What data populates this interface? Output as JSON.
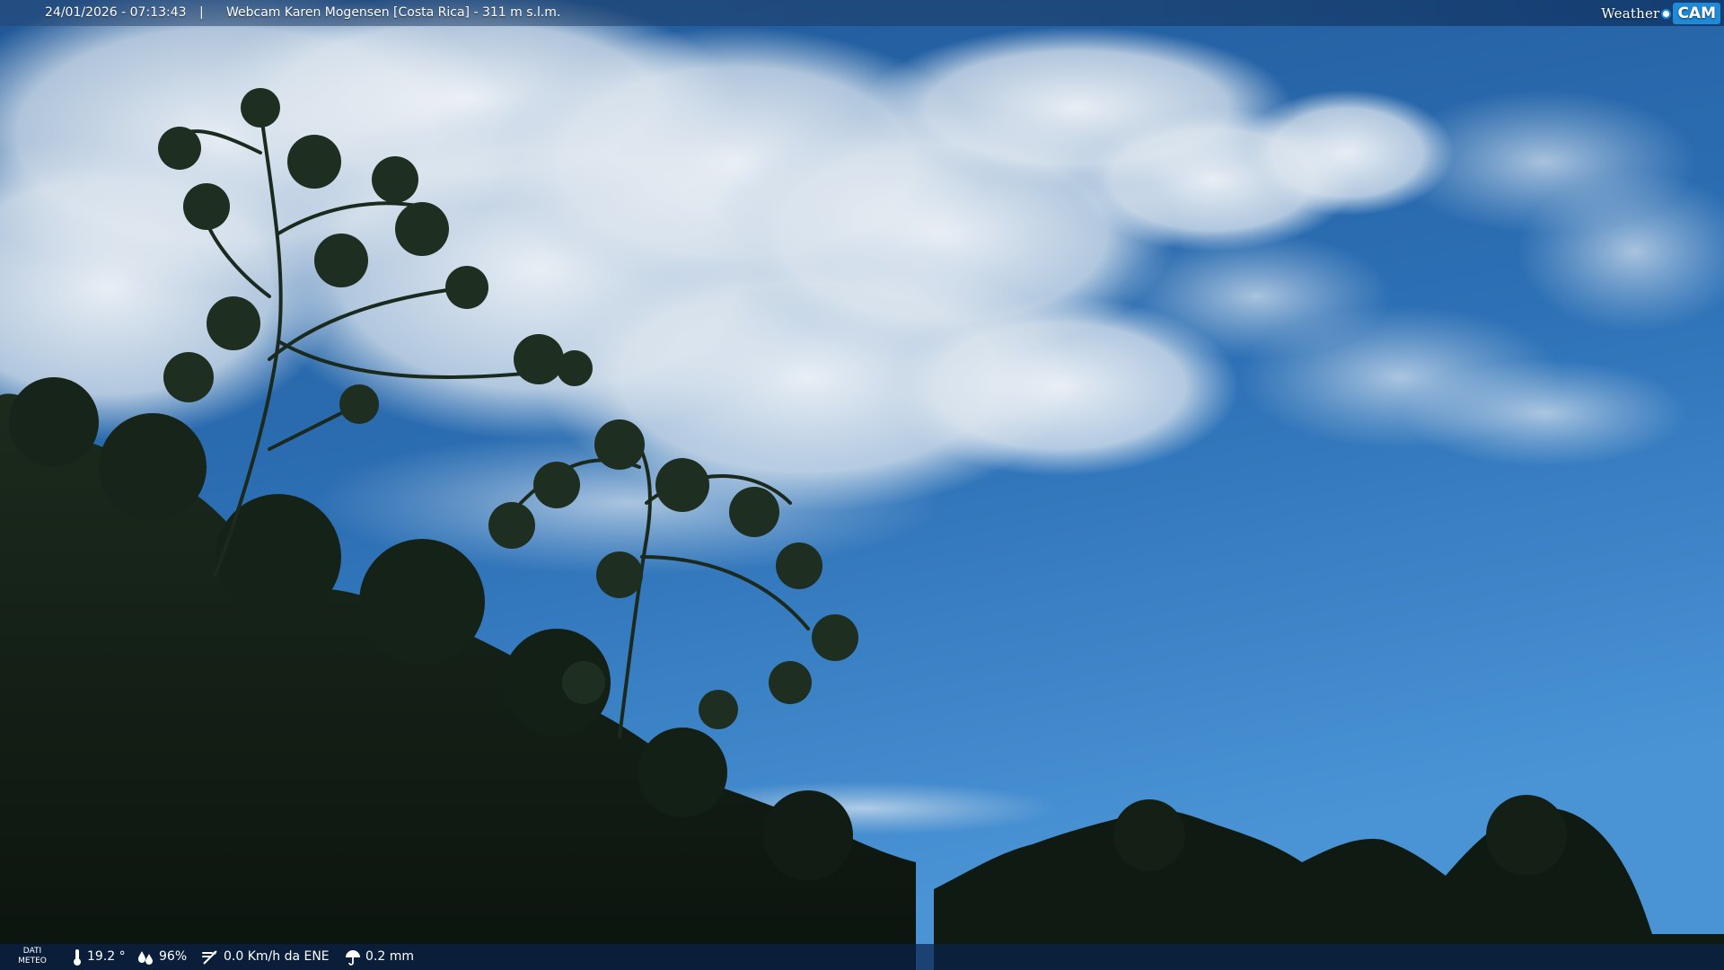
{
  "header": {
    "datetime": "24/01/2026 - 07:13:43",
    "separator": "|",
    "title": "Webcam Karen Mogensen [Costa Rica] - 311 m s.l.m."
  },
  "logo": {
    "weather_text": "Weather",
    "cam_text": "CAM",
    "accent_color": "#1f8ad6"
  },
  "footer": {
    "label_line1": "DATI",
    "label_line2": "METEO",
    "temperature": "19.2 °",
    "humidity": "96%",
    "wind": "0.0 Km/h da ENE",
    "rain": "0.2 mm"
  },
  "icons": {
    "temperature": "thermometer-icon",
    "humidity": "humidity-icon",
    "wind": "wind-icon",
    "rain": "umbrella-icon"
  },
  "scene": {
    "sky_top_color": "#225d9f",
    "sky_bottom_color": "#3b86cf",
    "cloud_color": "#e9eef3",
    "vegetation_color": "#101c14"
  }
}
